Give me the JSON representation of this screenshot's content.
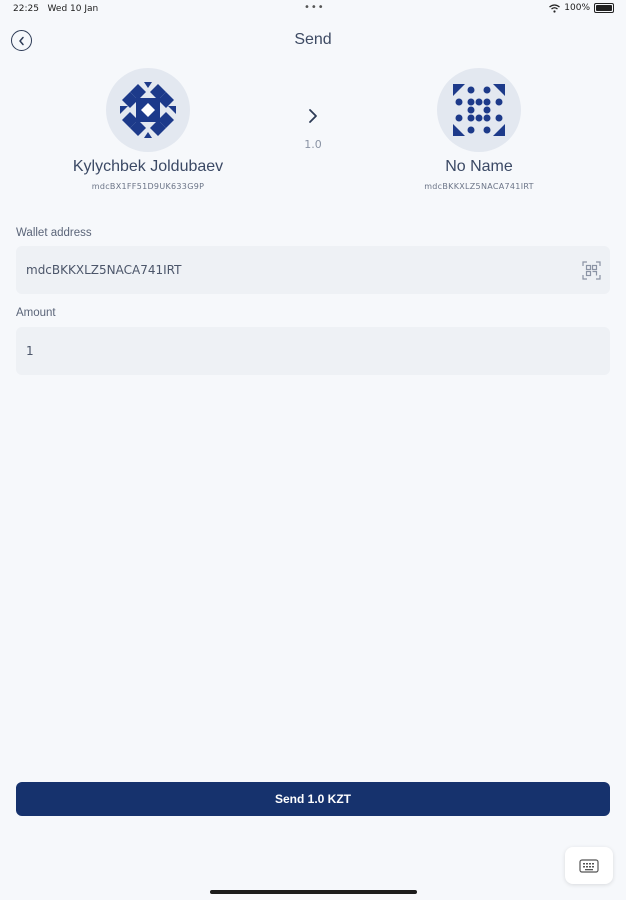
{
  "status_bar": {
    "time": "22:25",
    "date": "Wed 10 Jan",
    "dots": "•••",
    "battery": "100%"
  },
  "header": {
    "title": "Send",
    "back_icon": "back-arrow-circle-icon"
  },
  "sender": {
    "name": "Kylychbek Joldubaev",
    "address": "mdcBX1FF51D9UK633G9P",
    "avatar_icon": "identicon"
  },
  "transfer": {
    "arrow_icon": "chevron-right-icon",
    "amount": "1.0"
  },
  "recipient": {
    "name": "No Name",
    "address": "mdcBKKXLZ5NACA741IRT",
    "avatar_icon": "identicon"
  },
  "wallet_field": {
    "label": "Wallet address",
    "value": "mdcBKKXLZ5NACA741IRT",
    "scan_icon": "qr-scan-icon"
  },
  "amount_field": {
    "label": "Amount",
    "value": "1"
  },
  "send_button": {
    "label": "Send 1.0 KZT"
  },
  "keyboard_button": {
    "icon": "keyboard-icon"
  },
  "colors": {
    "primary": "#16326d",
    "avatar_fg": "#1d3a8a",
    "background": "#f6f8fb",
    "input_bg": "#eef1f5"
  }
}
